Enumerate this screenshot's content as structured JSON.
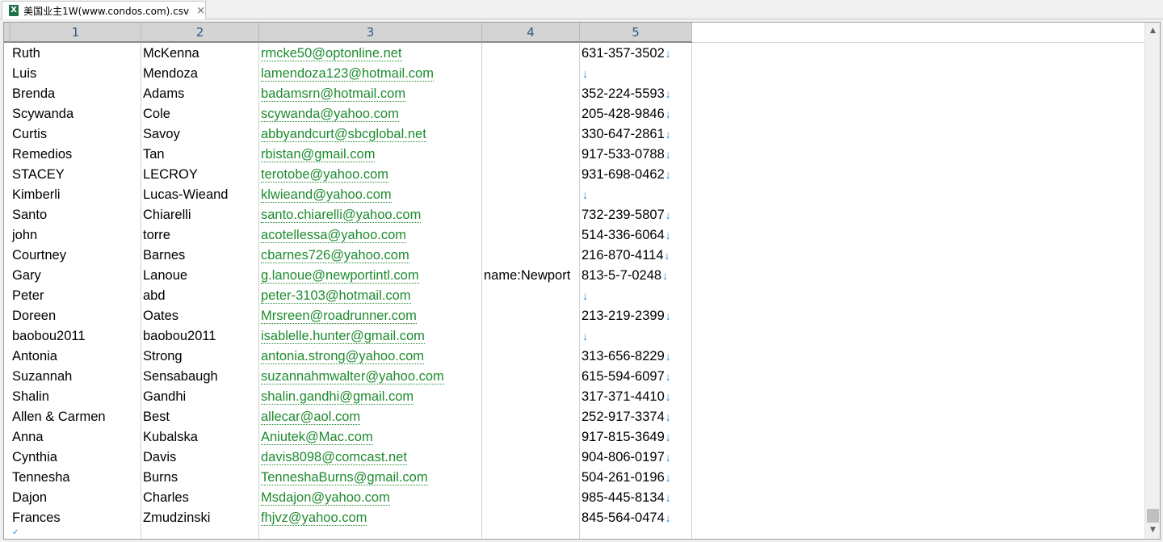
{
  "tab": {
    "icon": "excel-file-icon",
    "icon_letter": "X",
    "title": "美国业主1W(www.condos.com).csv",
    "close": "×"
  },
  "columns": [
    "1",
    "2",
    "3",
    "4",
    "5"
  ],
  "row_end_marker": "↓",
  "rows": [
    {
      "c1": "Ruth",
      "c2": "McKenna",
      "c3": "rmcke50@optonline.net",
      "c4": "",
      "c5": "631-357-3502"
    },
    {
      "c1": "Luis",
      "c2": "Mendoza",
      "c3": "lamendoza123@hotmail.com",
      "c4": "",
      "c5": ""
    },
    {
      "c1": "Brenda",
      "c2": "Adams",
      "c3": "badamsrn@hotmail.com",
      "c4": "",
      "c5": "352-224-5593"
    },
    {
      "c1": "Scywanda",
      "c2": "Cole",
      "c3": "scywanda@yahoo.com",
      "c4": "",
      "c5": "205-428-9846"
    },
    {
      "c1": "Curtis",
      "c2": "Savoy",
      "c3": "abbyandcurt@sbcglobal.net",
      "c4": "",
      "c5": "330-647-2861"
    },
    {
      "c1": "Remedios",
      "c2": "Tan",
      "c3": "rbistan@gmail.com",
      "c4": "",
      "c5": "917-533-0788"
    },
    {
      "c1": "STACEY",
      "c2": "LECROY",
      "c3": "terotobe@yahoo.com",
      "c4": "",
      "c5": "931-698-0462"
    },
    {
      "c1": "Kimberli",
      "c2": "Lucas-Wieand",
      "c3": "klwieand@yahoo.com",
      "c4": "",
      "c5": ""
    },
    {
      "c1": "Santo",
      "c2": "Chiarelli",
      "c3": "santo.chiarelli@yahoo.com",
      "c4": "",
      "c5": "732-239-5807"
    },
    {
      "c1": "john",
      "c2": "torre",
      "c3": "acotellessa@yahoo.com",
      "c4": "",
      "c5": "514-336-6064"
    },
    {
      "c1": "Courtney",
      "c2": "Barnes",
      "c3": "cbarnes726@yahoo.com",
      "c4": "",
      "c5": "216-870-4114"
    },
    {
      "c1": "Gary",
      "c2": "Lanoue",
      "c3": "g.lanoue@newportintl.com",
      "c4": "name:Newport",
      "c5": "813-5-7-0248"
    },
    {
      "c1": "Peter",
      "c2": "abd",
      "c3": "peter-3103@hotmail.com",
      "c4": "",
      "c5": ""
    },
    {
      "c1": "Doreen",
      "c2": "Oates",
      "c3": "Mrsreen@roadrunner.com",
      "c4": "",
      "c5": "213-219-2399"
    },
    {
      "c1": "baobou2011",
      "c2": "baobou2011",
      "c3": "isablelle.hunter@gmail.com",
      "c4": "",
      "c5": ""
    },
    {
      "c1": "Antonia",
      "c2": "Strong",
      "c3": "antonia.strong@yahoo.com",
      "c4": "",
      "c5": "313-656-8229"
    },
    {
      "c1": "Suzannah",
      "c2": "Sensabaugh",
      "c3": "suzannahmwalter@yahoo.com",
      "c4": "",
      "c5": "615-594-6097"
    },
    {
      "c1": "Shalin",
      "c2": "Gandhi",
      "c3": "shalin.gandhi@gmail.com",
      "c4": "",
      "c5": "317-371-4410"
    },
    {
      "c1": "Allen & Carmen",
      "c2": "Best",
      "c3": "allecar@aol.com",
      "c4": "",
      "c5": "252-917-3374"
    },
    {
      "c1": "Anna",
      "c2": "Kubalska",
      "c3": "Aniutek@Mac.com",
      "c4": "",
      "c5": "917-815-3649"
    },
    {
      "c1": "Cynthia",
      "c2": "Davis",
      "c3": "davis8098@comcast.net",
      "c4": "",
      "c5": "904-806-0197"
    },
    {
      "c1": "Tennesha",
      "c2": "Burns",
      "c3": "TenneshaBurns@gmail.com",
      "c4": "",
      "c5": "504-261-0196"
    },
    {
      "c1": "Dajon",
      "c2": "Charles",
      "c3": "Msdajon@yahoo.com",
      "c4": "",
      "c5": "985-445-8134"
    },
    {
      "c1": "Frances",
      "c2": "Zmudzinski",
      "c3": "fhjvz@yahoo.com",
      "c4": "",
      "c5": "845-564-0474"
    }
  ],
  "scrollbar": {
    "up_icon": "▲",
    "down_icon": "▼"
  }
}
